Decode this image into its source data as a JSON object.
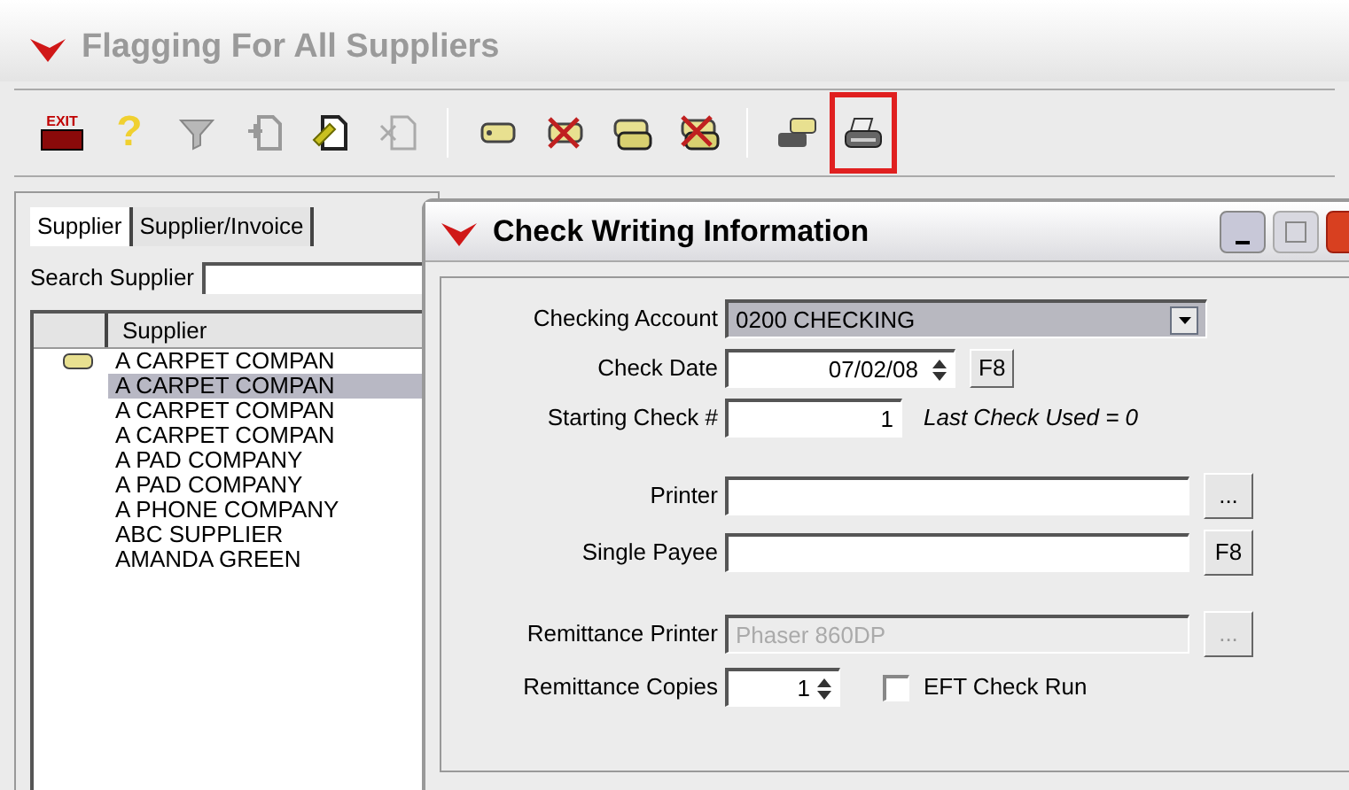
{
  "window": {
    "title": "Flagging For All Suppliers"
  },
  "toolbar": [
    {
      "kind": "exit",
      "label": "EXIT",
      "highlighted": false
    },
    {
      "kind": "help",
      "label": "?",
      "highlighted": false
    },
    {
      "kind": "filter",
      "highlighted": false
    },
    {
      "kind": "add",
      "highlighted": false
    },
    {
      "kind": "edit",
      "highlighted": false
    },
    {
      "kind": "delete",
      "highlighted": false
    },
    {
      "kind": "separator"
    },
    {
      "kind": "tag",
      "highlighted": false
    },
    {
      "kind": "tag-delete",
      "highlighted": false
    },
    {
      "kind": "tags",
      "highlighted": false
    },
    {
      "kind": "tags-delete",
      "highlighted": false
    },
    {
      "kind": "separator"
    },
    {
      "kind": "print-tag",
      "highlighted": false
    },
    {
      "kind": "print",
      "highlighted": true
    }
  ],
  "tabs": [
    {
      "label": "Supplier",
      "selected": true
    },
    {
      "label": "Supplier/Invoice",
      "selected": false
    }
  ],
  "search": {
    "label": "Search Supplier"
  },
  "grid": {
    "column": "Supplier",
    "rows": [
      {
        "name": "A CARPET COMPAN",
        "flagged": true,
        "selected": false
      },
      {
        "name": "A CARPET COMPAN",
        "flagged": false,
        "selected": true
      },
      {
        "name": "A CARPET COMPAN",
        "flagged": false,
        "selected": false
      },
      {
        "name": "A CARPET COMPAN",
        "flagged": false,
        "selected": false
      },
      {
        "name": "A PAD COMPANY",
        "flagged": false,
        "selected": false
      },
      {
        "name": "A PAD COMPANY",
        "flagged": false,
        "selected": false
      },
      {
        "name": "A PHONE COMPANY",
        "flagged": false,
        "selected": false
      },
      {
        "name": "ABC SUPPLIER",
        "flagged": false,
        "selected": false
      },
      {
        "name": "AMANDA GREEN",
        "flagged": false,
        "selected": false
      }
    ]
  },
  "dialog": {
    "title": "Check Writing Information",
    "sections": [
      [
        {
          "kind": "select",
          "label": "Checking Account",
          "value": "0200  CHECKING"
        },
        {
          "kind": "date",
          "label": "Check Date",
          "value": "07/02/08",
          "button": "F8"
        },
        {
          "kind": "number",
          "label": "Starting Check #",
          "value": "1",
          "note": "Last Check Used = 0"
        }
      ],
      [
        {
          "kind": "text",
          "label": "Printer",
          "button": "...",
          "disabled": false
        },
        {
          "kind": "text",
          "label": "Single Payee",
          "button": "F8",
          "disabled": false
        }
      ],
      [
        {
          "kind": "text",
          "label": "Remittance Printer",
          "value": "Phaser 860DP",
          "button": "...",
          "disabled": true
        },
        {
          "kind": "spinner",
          "label": "Remittance Copies",
          "value": "1",
          "checkbox": {
            "label": "EFT Check Run",
            "checked": false
          }
        }
      ]
    ]
  }
}
